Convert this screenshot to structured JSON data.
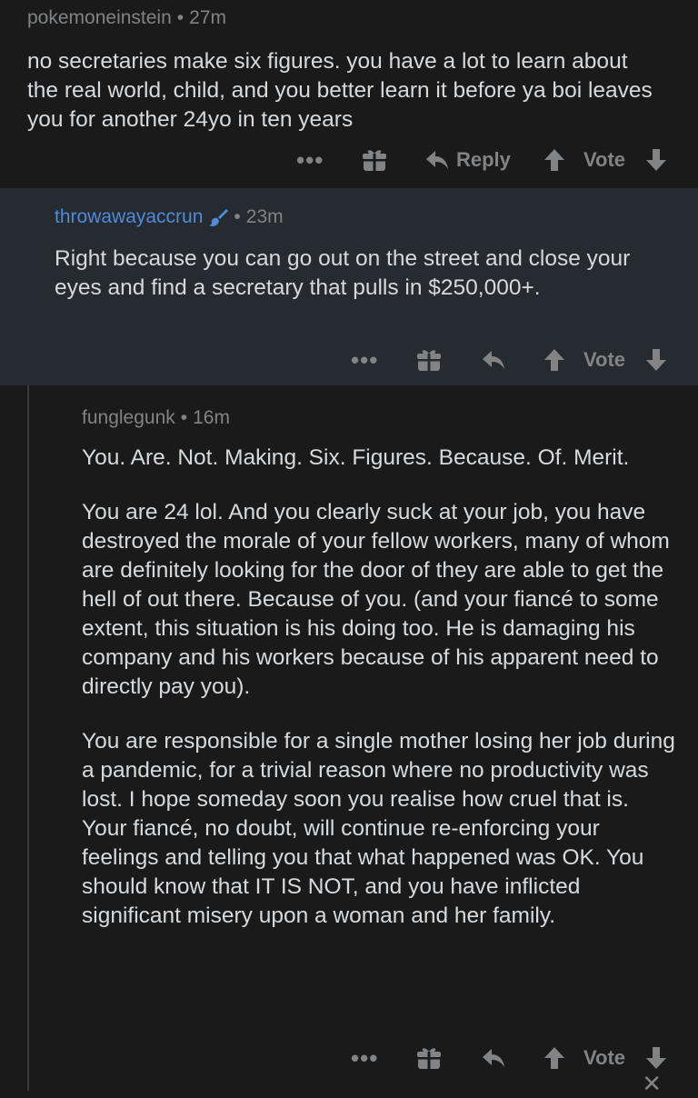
{
  "comments": [
    {
      "author": "pokemoneinstein",
      "time": "27m",
      "body": [
        "no secretaries make six figures. you have a lot to learn about the real world, child, and you better learn it before ya boi leaves you for another 24yo in ten years"
      ],
      "actions": {
        "more": "•••",
        "reply": "Reply",
        "vote": "Vote"
      }
    },
    {
      "author": "throwawayaccrun",
      "author_badge_icon": "brush-icon",
      "time": "23m",
      "body": [
        "Right because you can go out on the street and close your eyes and find a secretary that pulls in $250,000+."
      ],
      "actions": {
        "more": "•••",
        "vote": "Vote"
      }
    },
    {
      "author": "funglegunk",
      "time": "16m",
      "body": [
        "You. Are. Not. Making. Six. Figures. Because. Of. Merit.",
        "You are 24 lol. And you clearly suck at your job, you have destroyed the morale of your fellow workers, many of whom are definitely looking for the door of they are able to get the hell of out there. Because of you. (and your fiancé to some extent, this situation is his doing too. He is damaging his company and his workers because of his apparent need to directly pay you).",
        "You are responsible for a single mother losing her job during a pandemic, for a trivial reason where no productivity was lost. I hope someday soon you realise how cruel that is. Your fiancé, no doubt, will continue re-enforcing your feelings and telling you that what happened was OK. You should know that IT IS NOT, and you have inflicted significant misery upon a woman and her family."
      ],
      "actions": {
        "more": "•••",
        "vote": "Vote"
      }
    }
  ],
  "separator": "•",
  "colors": {
    "background": "#1a1a1b",
    "highlight": "#262a31",
    "text": "#d7dadc",
    "muted": "#818384",
    "author_link": "#4f8bd6"
  }
}
